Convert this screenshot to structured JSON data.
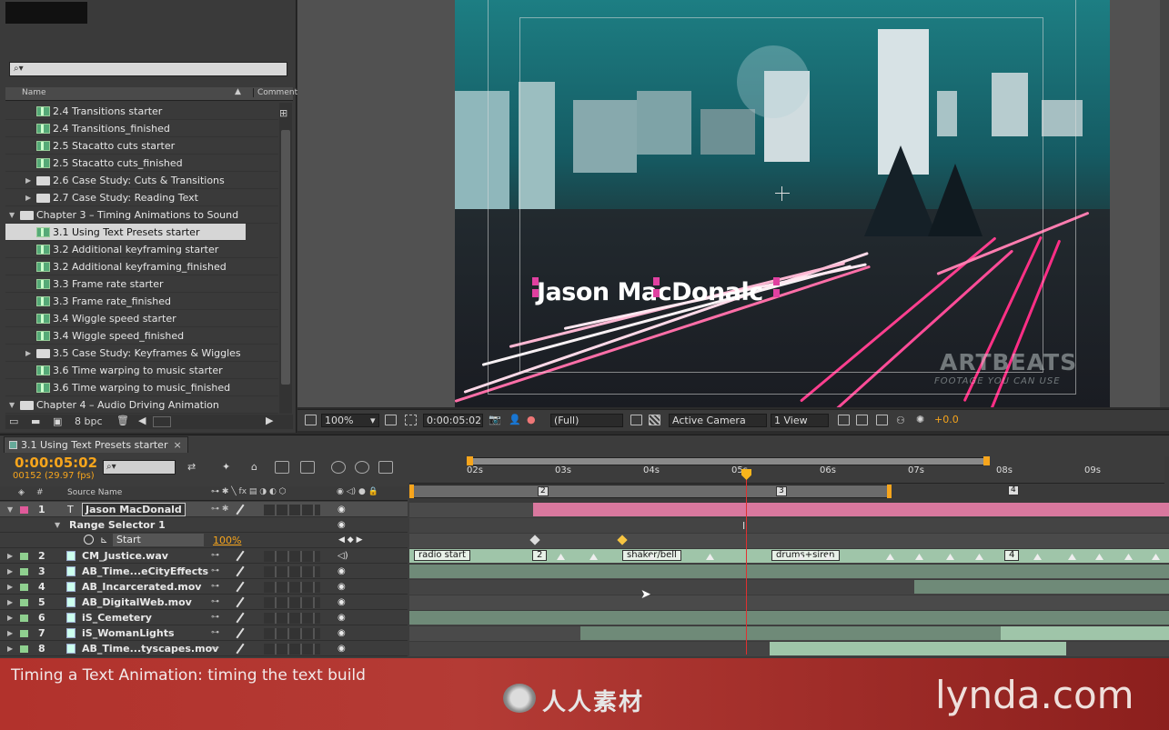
{
  "project": {
    "search_placeholder": "⌕▾",
    "col_name": "Name",
    "col_comment": "Comment",
    "items": [
      {
        "label": "2.4 Transitions starter",
        "type": "comp",
        "indent": 2
      },
      {
        "label": "2.4 Transitions_finished",
        "type": "comp",
        "indent": 2
      },
      {
        "label": "2.5 Stacatto cuts starter",
        "type": "comp",
        "indent": 2
      },
      {
        "label": "2.5 Stacatto cuts_finished",
        "type": "comp",
        "indent": 2
      },
      {
        "label": "2.6 Case Study: Cuts & Transitions",
        "type": "folder",
        "indent": 1
      },
      {
        "label": "2.7 Case Study: Reading Text",
        "type": "folder",
        "indent": 1
      },
      {
        "label": "Chapter 3 – Timing Animations to Sound",
        "type": "folder-open",
        "indent": 0
      },
      {
        "label": "3.1 Using Text Presets starter",
        "type": "comp",
        "indent": 2,
        "selected": true
      },
      {
        "label": "3.2 Additional keyframing starter",
        "type": "comp",
        "indent": 2
      },
      {
        "label": "3.2 Additional keyframing_finished",
        "type": "comp",
        "indent": 2
      },
      {
        "label": "3.3 Frame rate starter",
        "type": "comp",
        "indent": 2
      },
      {
        "label": "3.3 Frame rate_finished",
        "type": "comp",
        "indent": 2
      },
      {
        "label": "3.4 Wiggle speed starter",
        "type": "comp",
        "indent": 2
      },
      {
        "label": "3.4 Wiggle speed_finished",
        "type": "comp",
        "indent": 2
      },
      {
        "label": "3.5 Case Study: Keyframes & Wiggles",
        "type": "folder",
        "indent": 1
      },
      {
        "label": "3.6 Time warping to music starter",
        "type": "comp",
        "indent": 2
      },
      {
        "label": "3.6 Time warping to music_finished",
        "type": "comp",
        "indent": 2
      },
      {
        "label": "Chapter 4 – Audio Driving Animation",
        "type": "folder-open",
        "indent": 0
      }
    ],
    "bit_depth": "8 bpc"
  },
  "viewer": {
    "overlay_text": "Jason MacDonalc",
    "watermark_top": "ARTBEATS",
    "watermark_bottom": "FOOTAGE YOU CAN USE",
    "zoom": "100%",
    "timecode": "0:00:05:02",
    "resolution": "(Full)",
    "camera": "Active Camera",
    "view": "1 View",
    "exposure": "+0.0"
  },
  "timeline": {
    "tab_label": "3.1 Using Text Presets starter",
    "tab_close": "×",
    "timecode": "0:00:05:02",
    "frames": "00152 (29.97 fps)",
    "search_placeholder": "⌕▾",
    "col_hash": "#",
    "col_source": "Source Name",
    "ruler_ticks": [
      "02s",
      "03s",
      "04s",
      "05s",
      "06s",
      "07s",
      "08s",
      "09s"
    ],
    "layers": [
      {
        "num": "1",
        "name": "Jason MacDonald",
        "color": "#e05a9a",
        "kind": "text"
      },
      {
        "num": "2",
        "name": "CM_Justice.wav",
        "color": "#8fd08f",
        "kind": "audio"
      },
      {
        "num": "3",
        "name": "AB_Time...eCityEffects",
        "color": "#8fd08f",
        "kind": "video"
      },
      {
        "num": "4",
        "name": "AB_Incarcerated.mov",
        "color": "#8fd08f",
        "kind": "video"
      },
      {
        "num": "5",
        "name": "AB_DigitalWeb.mov",
        "color": "#8fd08f",
        "kind": "video"
      },
      {
        "num": "6",
        "name": "iS_Cemetery",
        "color": "#8fd08f",
        "kind": "video"
      },
      {
        "num": "7",
        "name": "iS_WomanLights",
        "color": "#8fd08f",
        "kind": "video"
      },
      {
        "num": "8",
        "name": "AB_Time...tyscapes.mov",
        "color": "#8fd08f",
        "kind": "video"
      }
    ],
    "range_selector": "Range Selector 1",
    "start_label": "Start",
    "start_value": "100%",
    "markers": [
      "2",
      "3",
      "4"
    ],
    "audio_markers": [
      "radio start",
      "2",
      "shaker/bell",
      "drums+siren",
      "4"
    ]
  },
  "caption": {
    "text": "Timing a Text Animation: timing the text build",
    "logo_cn": "人人素材",
    "brand": "lynda.com"
  }
}
